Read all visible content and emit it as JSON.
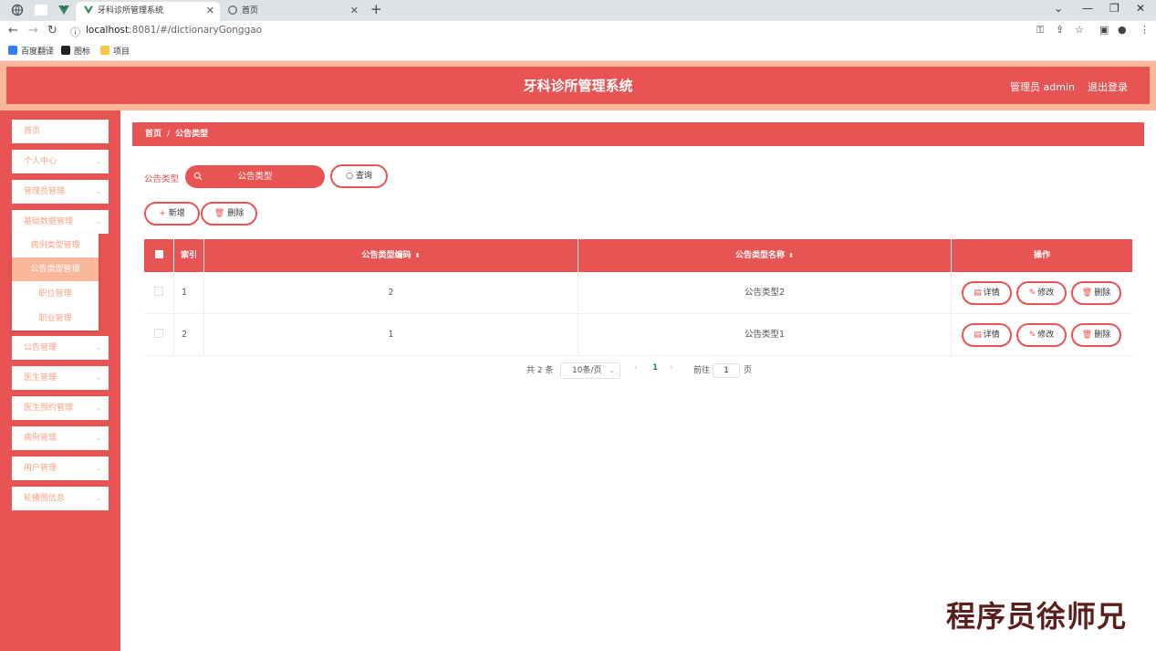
{
  "browser": {
    "tabs": [
      {
        "title": "牙科诊所管理系统",
        "active": true
      },
      {
        "title": "首页",
        "active": false
      }
    ],
    "url_host": "localhost",
    "url_path": ":8081/#/dictionaryGonggao",
    "bookmarks": [
      "百度翻译",
      "图标",
      "项目"
    ]
  },
  "header": {
    "title": "牙科诊所管理系统",
    "user": "管理员 admin",
    "logout": "退出登录"
  },
  "sidebar": {
    "items": [
      {
        "label": "首页",
        "has_arrow": false
      },
      {
        "label": "个人中心",
        "has_arrow": true
      },
      {
        "label": "管理员管理",
        "has_arrow": true
      },
      {
        "label": "基础数据管理",
        "has_arrow": true
      },
      {
        "label": "公告管理",
        "has_arrow": true
      },
      {
        "label": "医生管理",
        "has_arrow": true
      },
      {
        "label": "医生预约管理",
        "has_arrow": true
      },
      {
        "label": "病例管理",
        "has_arrow": true
      },
      {
        "label": "用户管理",
        "has_arrow": true
      },
      {
        "label": "轮播图信息",
        "has_arrow": true
      }
    ],
    "submenu": [
      {
        "label": "病例类型管理",
        "active": false
      },
      {
        "label": "公告类型管理",
        "active": true
      },
      {
        "label": "职位管理",
        "active": false
      },
      {
        "label": "职业管理",
        "active": false
      }
    ]
  },
  "breadcrumb": {
    "home": "首页",
    "sep": "/",
    "current": "公告类型"
  },
  "search": {
    "label": "公告类型",
    "placeholder": "公告类型",
    "query_button": "查询"
  },
  "actions": {
    "add": "新增",
    "delete": "删除"
  },
  "table": {
    "headers": {
      "index": "索引",
      "code": "公告类型编码",
      "name": "公告类型名称",
      "ops": "操作"
    },
    "rows": [
      {
        "index": "1",
        "code": "2",
        "name": "公告类型2"
      },
      {
        "index": "2",
        "code": "1",
        "name": "公告类型1"
      }
    ],
    "row_buttons": {
      "detail": "详情",
      "edit": "修改",
      "delete": "删除"
    }
  },
  "pagination": {
    "total": "共 2 条",
    "page_size": "10条/页",
    "current_page": "1",
    "goto_label": "前往",
    "goto_value": "1",
    "page_unit": "页"
  },
  "watermark": "程序员徐师兄",
  "colors": {
    "primary": "#e85353",
    "accent": "#fbb79a"
  }
}
